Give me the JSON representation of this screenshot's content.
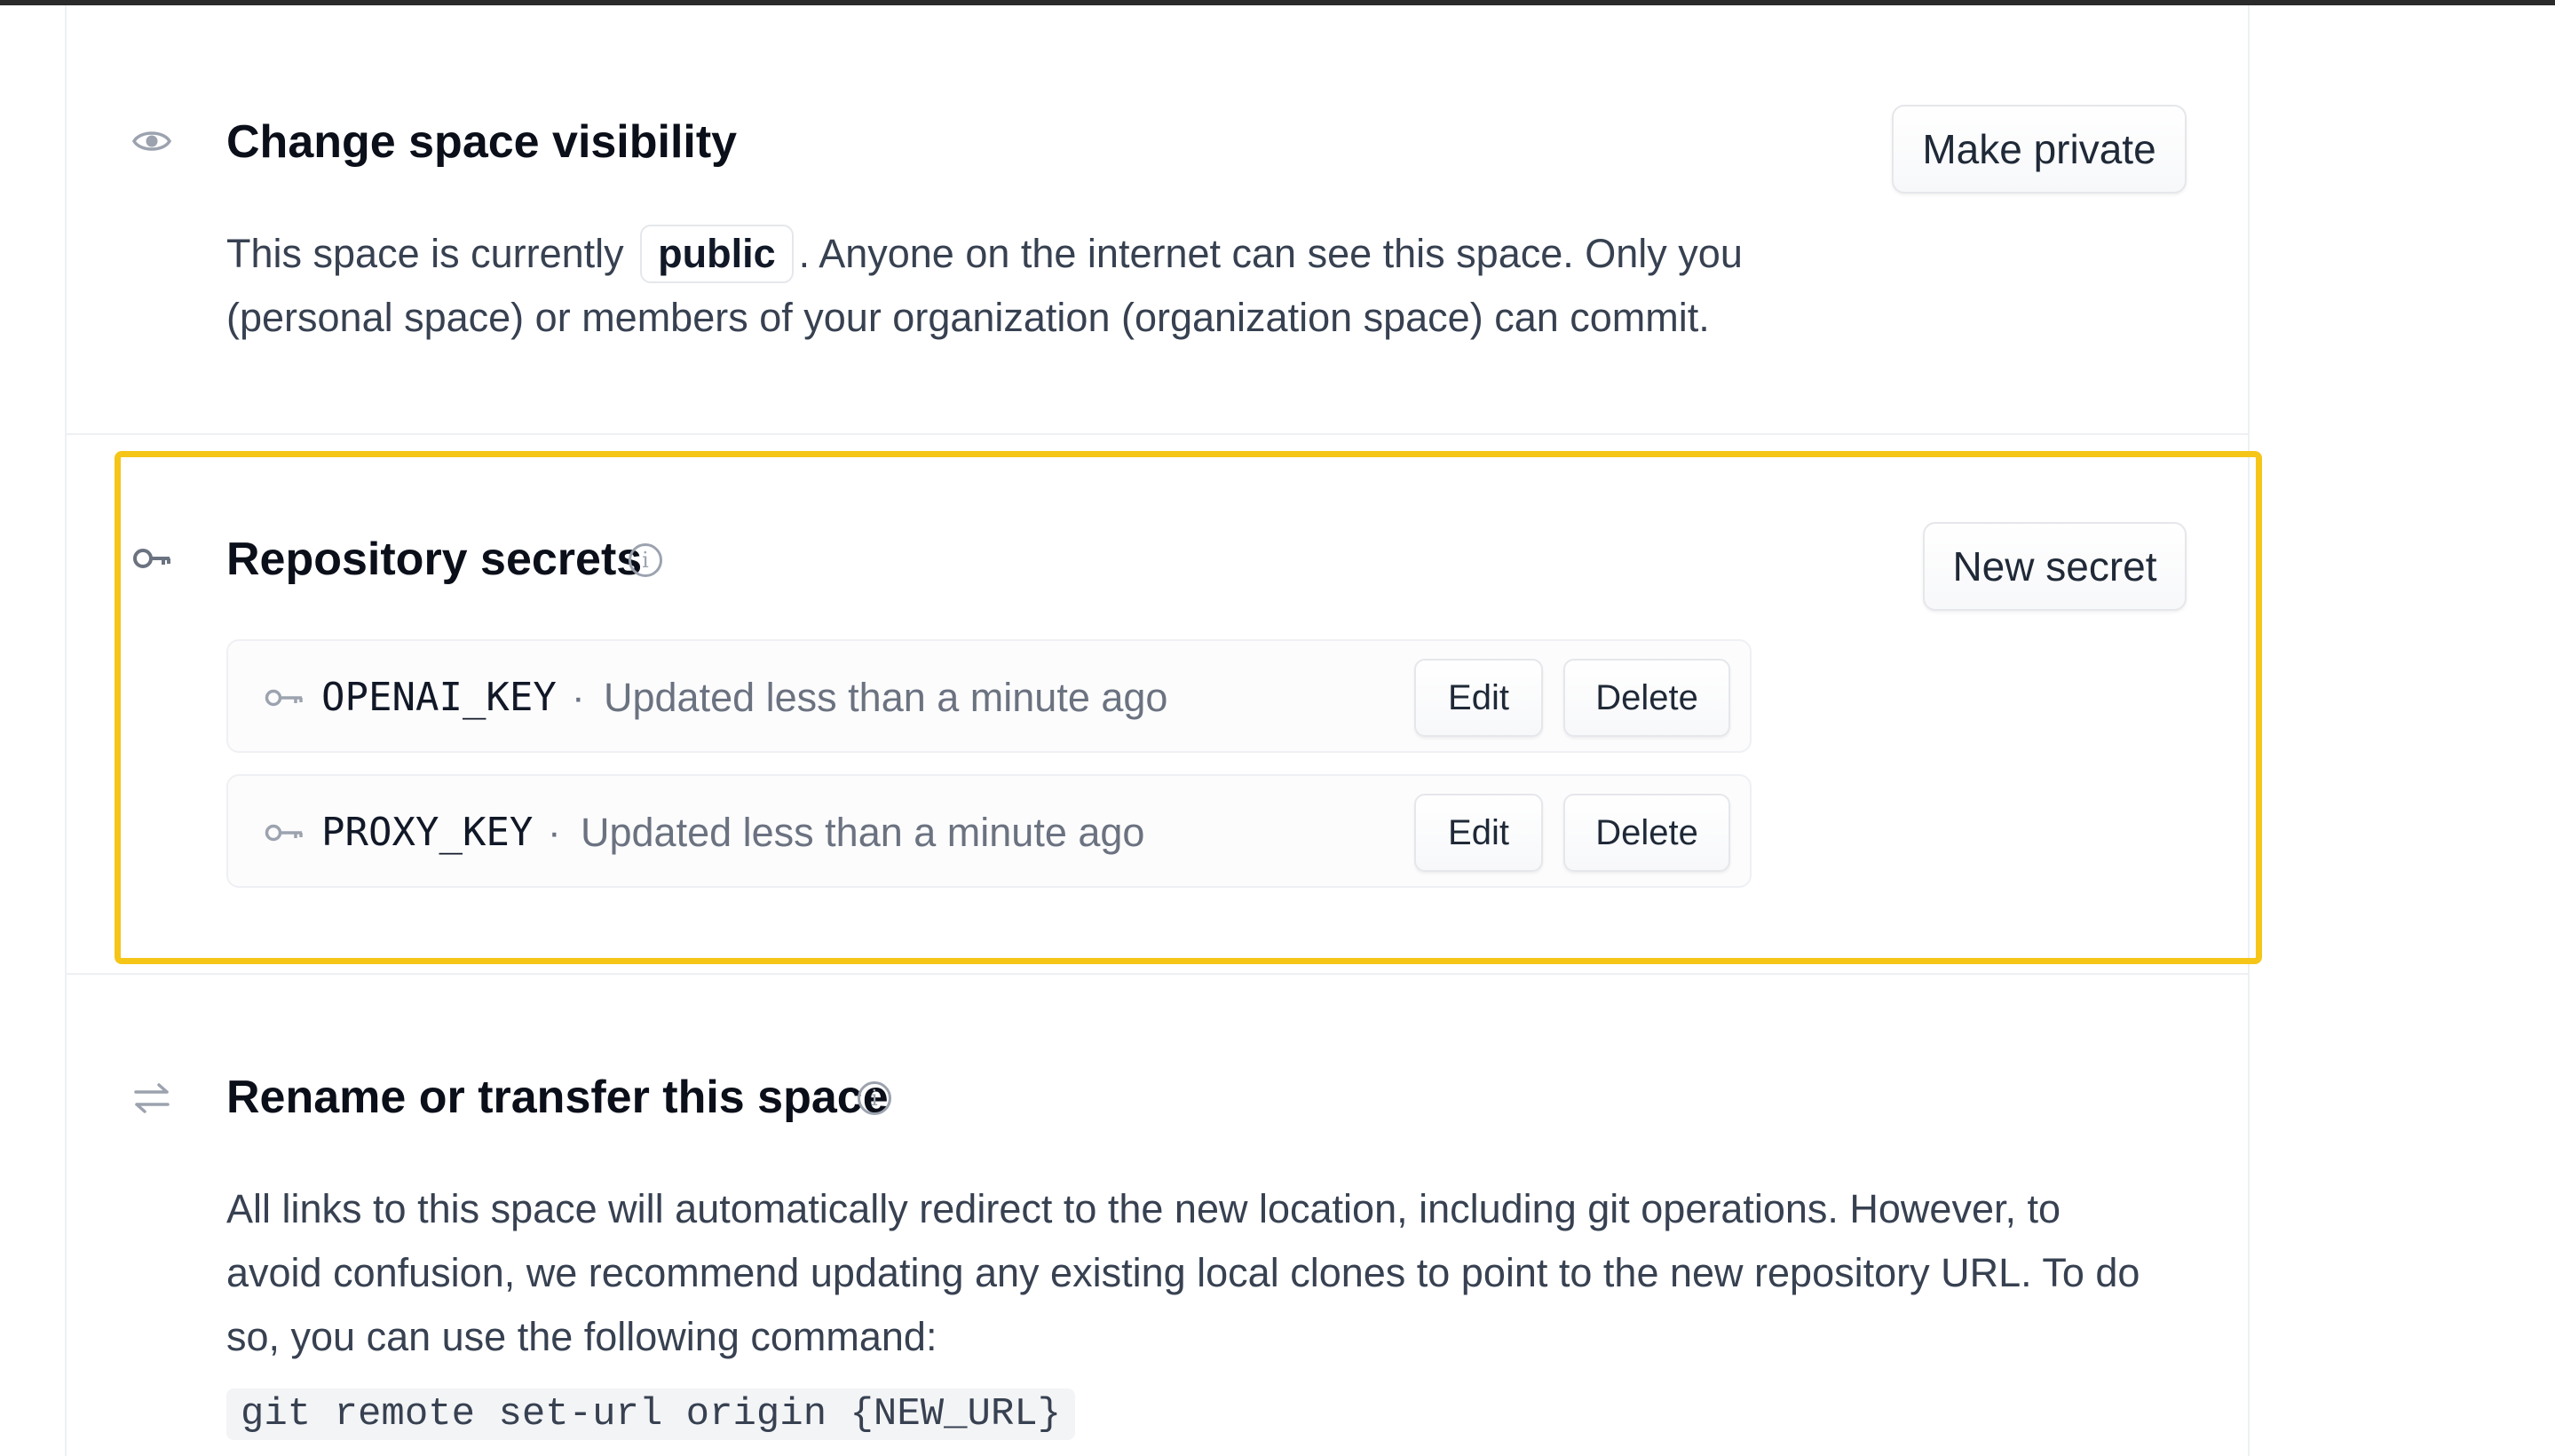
{
  "visibility": {
    "title": "Change space visibility",
    "button_label": "Make private",
    "desc_before": "This space is currently",
    "status": "public",
    "desc_after": ". Anyone on the internet can see this space. Only you",
    "desc_line2": "(personal space) or members of your organization (organization space) can commit.",
    "icon": "eye-icon"
  },
  "secrets": {
    "title": "Repository secrets",
    "button_label": "New secret",
    "icon": "key-icon",
    "info_icon": "info-icon",
    "highlight_color": "#f5c518",
    "items": [
      {
        "name": "OPENAI_KEY",
        "separator": "·",
        "updated": "Updated less than a minute ago",
        "edit_label": "Edit",
        "delete_label": "Delete"
      },
      {
        "name": "PROXY_KEY",
        "separator": "·",
        "updated": "Updated less than a minute ago",
        "edit_label": "Edit",
        "delete_label": "Delete"
      }
    ]
  },
  "rename": {
    "title": "Rename or transfer this space",
    "icon": "transfer-arrows-icon",
    "info_icon": "info-icon",
    "desc_lines": [
      "All links to this space will automatically redirect to the new location, including git operations. However, to",
      "avoid confusion, we recommend updating any existing local clones to point to the new repository URL. To do",
      "so, you can use the following command:"
    ],
    "command": "git remote set-url origin {NEW_URL}"
  }
}
